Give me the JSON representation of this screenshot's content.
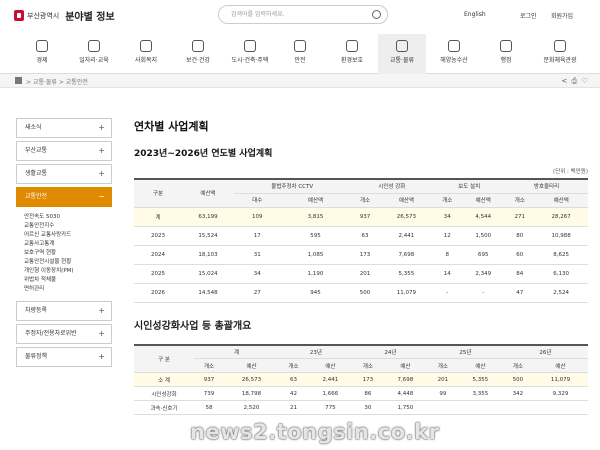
{
  "header": {
    "logo_sub": "부산광역시",
    "logo_main": "분야별 정보",
    "search_placeholder": "검색어를 입력하세요.",
    "util": [
      "English",
      "로그인",
      "회원가입"
    ]
  },
  "topnav": [
    {
      "label": "경제",
      "icon": "economy-icon"
    },
    {
      "label": "일자리·교육",
      "icon": "job-icon"
    },
    {
      "label": "사회복지",
      "icon": "welfare-icon"
    },
    {
      "label": "보건·건강",
      "icon": "health-icon"
    },
    {
      "label": "도시·건축·주택",
      "icon": "city-icon"
    },
    {
      "label": "안전",
      "icon": "safety-icon"
    },
    {
      "label": "환경보호",
      "icon": "environment-icon"
    },
    {
      "label": "교통·물류",
      "icon": "traffic-icon"
    },
    {
      "label": "해양농수산",
      "icon": "ocean-icon"
    },
    {
      "label": "행정",
      "icon": "admin-icon"
    },
    {
      "label": "문화체육관광",
      "icon": "culture-icon"
    }
  ],
  "breadcrumb": [
    "교통·물류",
    "교통안전"
  ],
  "sidebar": {
    "items_top": [
      "새소식",
      "부산교통",
      "생활교통"
    ],
    "active": "교통안전",
    "subnav": [
      "안전속도 5030",
      "교통안전지수",
      "어르신 교통사랑카드",
      "교통사고통계",
      "보호구역 현황",
      "교통안전시설물 현황",
      "개인형 이동장치(PM)",
      "위법차 적체불",
      "면허관리"
    ],
    "items_bottom": [
      "차량등록",
      "주정차/전용차로위반",
      "물류정책"
    ]
  },
  "main": {
    "page_title": "연차별 사업계획",
    "sub_title": "2023년~2026년 연도별 사업계획",
    "unit": "(단위 : 백만원)",
    "table1": {
      "h_gubun": "구분",
      "h_budget": "예산액",
      "groups": [
        "불법주정차 CCTV",
        "시인성 강화",
        "보도 설치",
        "방호울타리"
      ],
      "sub": [
        "대수",
        "예산액",
        "개소",
        "예산액",
        "개소",
        "예산액",
        "개소",
        "예산액"
      ],
      "rows": [
        [
          "계",
          "63,199",
          "109",
          "3,815",
          "937",
          "26,573",
          "34",
          "4,544",
          "271",
          "28,267"
        ],
        [
          "2023",
          "15,524",
          "17",
          "595",
          "63",
          "2,441",
          "12",
          "1,500",
          "80",
          "10,988"
        ],
        [
          "2024",
          "18,103",
          "31",
          "1,085",
          "173",
          "7,698",
          "8",
          "695",
          "60",
          "8,625"
        ],
        [
          "2025",
          "15,024",
          "34",
          "1,190",
          "201",
          "5,355",
          "14",
          "2,349",
          "84",
          "6,130"
        ],
        [
          "2026",
          "14,548",
          "27",
          "945",
          "500",
          "11,079",
          "-",
          "-",
          "47",
          "2,524"
        ]
      ]
    },
    "section2_title": "시인성강화사업 등 총괄개요",
    "table2": {
      "h_gubun": "구 분",
      "groups": [
        "계",
        "23년",
        "24년",
        "25년",
        "26년"
      ],
      "sub": [
        "개소",
        "예산",
        "개소",
        "예산",
        "개소",
        "예산",
        "개소",
        "예산",
        "개소",
        "예산"
      ],
      "rows": [
        [
          "소 계",
          "937",
          "26,573",
          "63",
          "2,441",
          "173",
          "7,698",
          "201",
          "5,355",
          "500",
          "11,079"
        ],
        [
          "시인성강화",
          "739",
          "18,798",
          "42",
          "1,666",
          "86",
          "4,448",
          "99",
          "3,355",
          "342",
          "9,329"
        ],
        [
          "과속·신호기",
          "58",
          "2,520",
          "21",
          "775",
          "30",
          "1,750",
          "",
          "",
          "",
          ""
        ]
      ]
    }
  },
  "watermark": "news2.tongsin.co.kr"
}
